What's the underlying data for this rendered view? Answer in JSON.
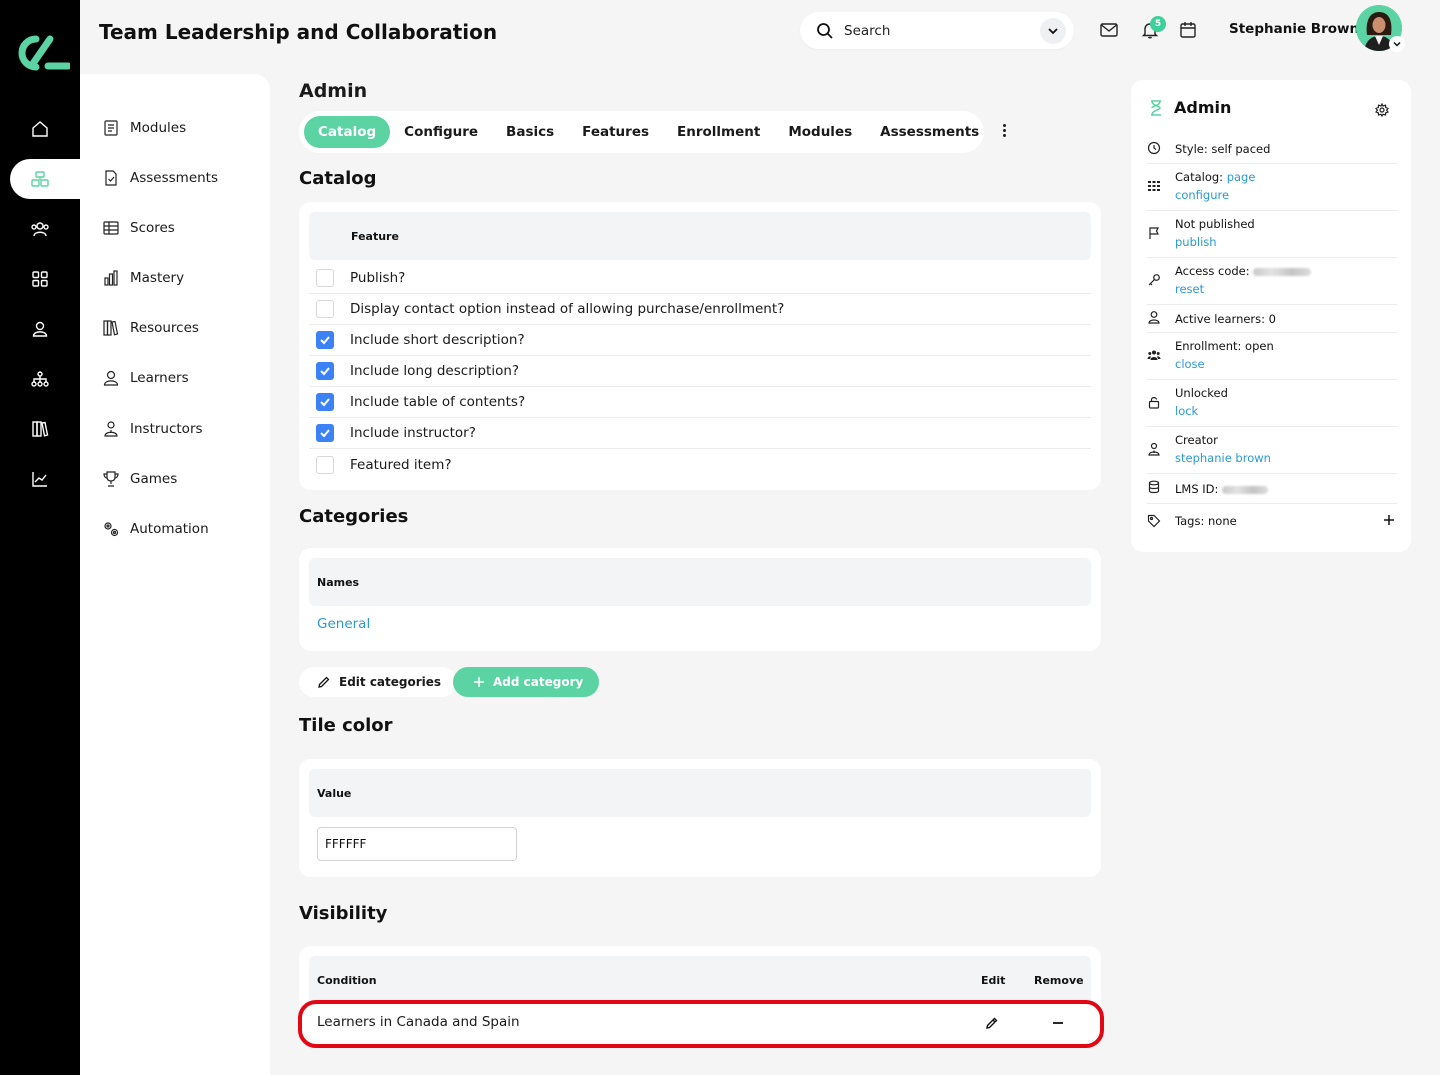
{
  "header": {
    "title": "Team Leadership and Collaboration",
    "search_label": "Search",
    "notifications_count": "5",
    "user_name": "Stephanie Brown"
  },
  "subnav": {
    "items": [
      {
        "label": "Modules",
        "icon": "book-icon"
      },
      {
        "label": "Assessments",
        "icon": "document-check-icon"
      },
      {
        "label": "Scores",
        "icon": "table-icon"
      },
      {
        "label": "Mastery",
        "icon": "bar-chart-icon"
      },
      {
        "label": "Resources",
        "icon": "library-icon"
      },
      {
        "label": "Learners",
        "icon": "user-icon"
      },
      {
        "label": "Instructors",
        "icon": "instructor-icon"
      },
      {
        "label": "Games",
        "icon": "trophy-icon"
      },
      {
        "label": "Automation",
        "icon": "gears-icon"
      }
    ]
  },
  "main": {
    "heading": "Admin",
    "tabs": [
      "Catalog",
      "Configure",
      "Basics",
      "Features",
      "Enrollment",
      "Modules",
      "Assessments"
    ],
    "active_tab": "Catalog",
    "catalog": {
      "title": "Catalog",
      "column": "Feature",
      "rows": [
        {
          "label": "Publish?",
          "checked": false
        },
        {
          "label": "Display contact option instead of allowing purchase/enrollment?",
          "checked": false
        },
        {
          "label": "Include short description?",
          "checked": true
        },
        {
          "label": "Include long description?",
          "checked": true
        },
        {
          "label": "Include table of contents?",
          "checked": true
        },
        {
          "label": "Include instructor?",
          "checked": true
        },
        {
          "label": "Featured item?",
          "checked": false
        }
      ]
    },
    "categories": {
      "title": "Categories",
      "column": "Names",
      "items": [
        "General"
      ],
      "edit_button": "Edit categories",
      "add_button": "Add category"
    },
    "tile_color": {
      "title": "Tile color",
      "column": "Value",
      "value": "FFFFFF"
    },
    "visibility": {
      "title": "Visibility",
      "col_condition": "Condition",
      "col_edit": "Edit",
      "col_remove": "Remove",
      "rows": [
        {
          "condition": "Learners in Canada and Spain"
        }
      ]
    }
  },
  "panel": {
    "title": "Admin",
    "style_label": "Style: self paced",
    "catalog_label": "Catalog:",
    "catalog_page": "page",
    "catalog_configure": "configure",
    "published_label": "Not published",
    "publish_link": "publish",
    "access_label": "Access code:",
    "access_reset": "reset",
    "learners_label": "Active learners: 0",
    "enrollment_label": "Enrollment: open",
    "enrollment_link": "close",
    "lock_label": "Unlocked",
    "lock_link": "lock",
    "creator_label": "Creator",
    "creator_link": "stephanie brown",
    "lms_label": "LMS ID:",
    "tags_label": "Tags: none"
  },
  "colors": {
    "accent": "#5cd3a2",
    "checkbox": "#3b82f6",
    "link": "#2a9ad4",
    "highlight": "#e30613"
  }
}
